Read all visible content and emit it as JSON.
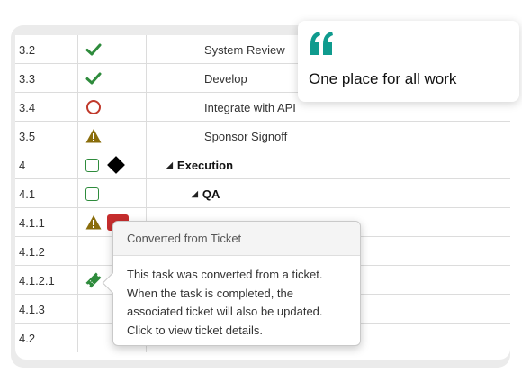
{
  "rows": [
    {
      "num": "3.2",
      "name": "System Review",
      "icons": [
        "check-icon"
      ]
    },
    {
      "num": "3.3",
      "name": "Develop",
      "icons": [
        "check-icon"
      ]
    },
    {
      "num": "3.4",
      "name": "Integrate with API",
      "icons": [
        "circle-icon"
      ]
    },
    {
      "num": "3.5",
      "name": "Sponsor Signoff",
      "icons": [
        "warning-icon"
      ]
    },
    {
      "num": "4",
      "name": "Execution",
      "icons": [
        "square-icon",
        "diamond-icon"
      ],
      "bold": true
    },
    {
      "num": "4.1",
      "name": "QA",
      "icons": [
        "square-icon"
      ],
      "bold": true
    },
    {
      "num": "4.1.1",
      "name": "",
      "icons": [
        "warning-icon",
        "red-flag-icon"
      ]
    },
    {
      "num": "4.1.2",
      "name": "",
      "icons": []
    },
    {
      "num": "4.1.2.1",
      "name": "",
      "icons": [
        "ticket-icon"
      ]
    },
    {
      "num": "4.1.3",
      "name": "",
      "icons": []
    },
    {
      "num": "4.2",
      "name": "",
      "icons": []
    }
  ],
  "quote": {
    "mark": "“",
    "text": "One place for all work"
  },
  "tooltip": {
    "title": "Converted from Ticket",
    "lines": [
      "This task was converted from a ticket.",
      "When the task is completed, the",
      "associated ticket will also be updated.",
      "Click to view ticket details."
    ]
  },
  "colors": {
    "check": "#2e8b3c",
    "circle": "#c0392b",
    "warning": "#8a6d0b",
    "quote_accent": "#0f9b8e"
  }
}
